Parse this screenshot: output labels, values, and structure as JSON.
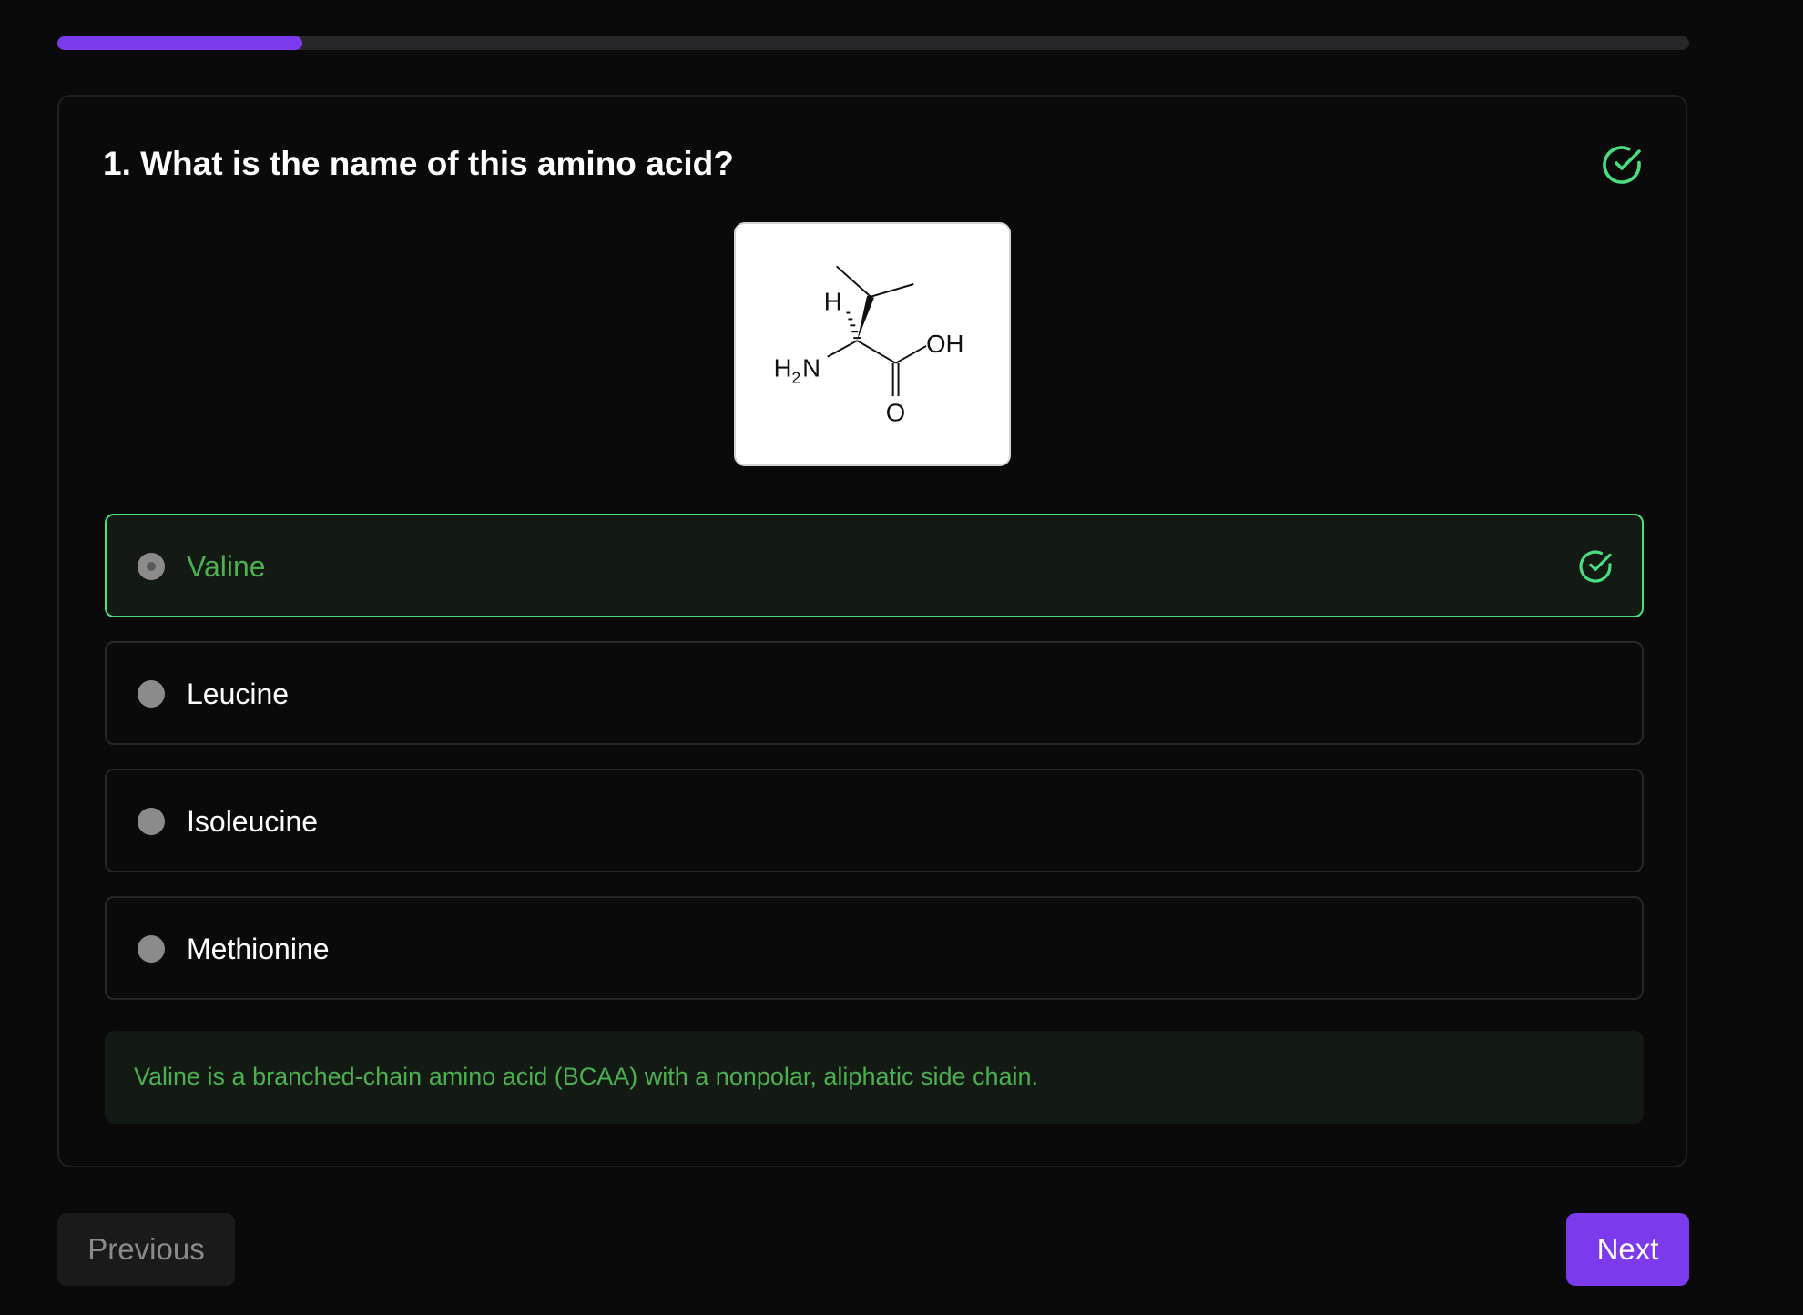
{
  "progress": {
    "fraction": 0.15
  },
  "question": {
    "title": "1. What is the name of this amino acid?",
    "status_icon": "check-circle-icon",
    "image": {
      "subject": "valine skeletal structure",
      "labels": {
        "h": "H",
        "nh2_h": "H",
        "nh2_sub": "2",
        "nh2_n": "N",
        "oh": "OH",
        "o": "O"
      }
    }
  },
  "options": [
    {
      "label": "Valine",
      "state": "correct-selected"
    },
    {
      "label": "Leucine",
      "state": "default"
    },
    {
      "label": "Isoleucine",
      "state": "default"
    },
    {
      "label": "Methionine",
      "state": "default"
    }
  ],
  "explanation": {
    "text": "Valine is a branched-chain amino acid (BCAA) with a nonpolar, aliphatic side chain."
  },
  "navigation": {
    "previous_label": "Previous",
    "next_label": "Next"
  },
  "colors": {
    "accent": "#7c3aed",
    "success": "#4ade80",
    "success_text": "#4caf50",
    "background": "#0a0a0a"
  }
}
